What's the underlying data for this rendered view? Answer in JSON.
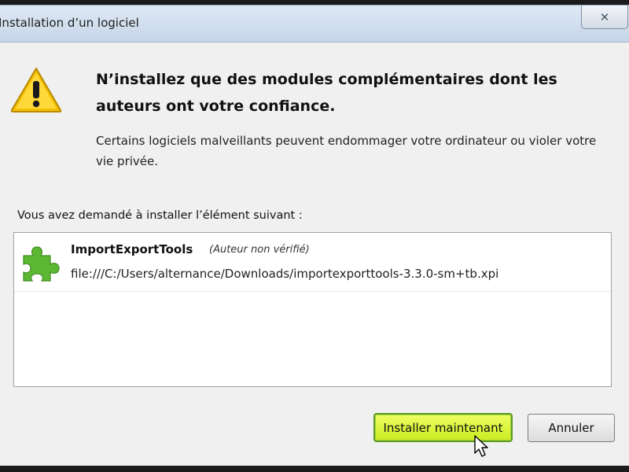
{
  "window": {
    "title": "Installation d’un logiciel",
    "close_icon": "close-icon"
  },
  "warning": {
    "icon": "warning-icon",
    "heading": "N’installez que des modules complémentaires dont les auteurs ont votre confiance.",
    "description": "Certains logiciels malveillants peuvent endommager votre ordinateur ou violer votre vie privée."
  },
  "request": {
    "label": "Vous avez demandé à installer l’élément suivant :"
  },
  "items": [
    {
      "icon": "puzzle-piece-icon",
      "name": "ImportExportTools",
      "author": "(Auteur non vérifié)",
      "path": "file:///C:/Users/alternance/Downloads/importexporttools-3.3.0-sm+tb.xpi"
    }
  ],
  "buttons": {
    "install": "Installer maintenant",
    "cancel": "Annuler"
  },
  "colors": {
    "install_button": "#d8f53a",
    "puzzle": "#5cb832",
    "warning": "#f5c400"
  }
}
